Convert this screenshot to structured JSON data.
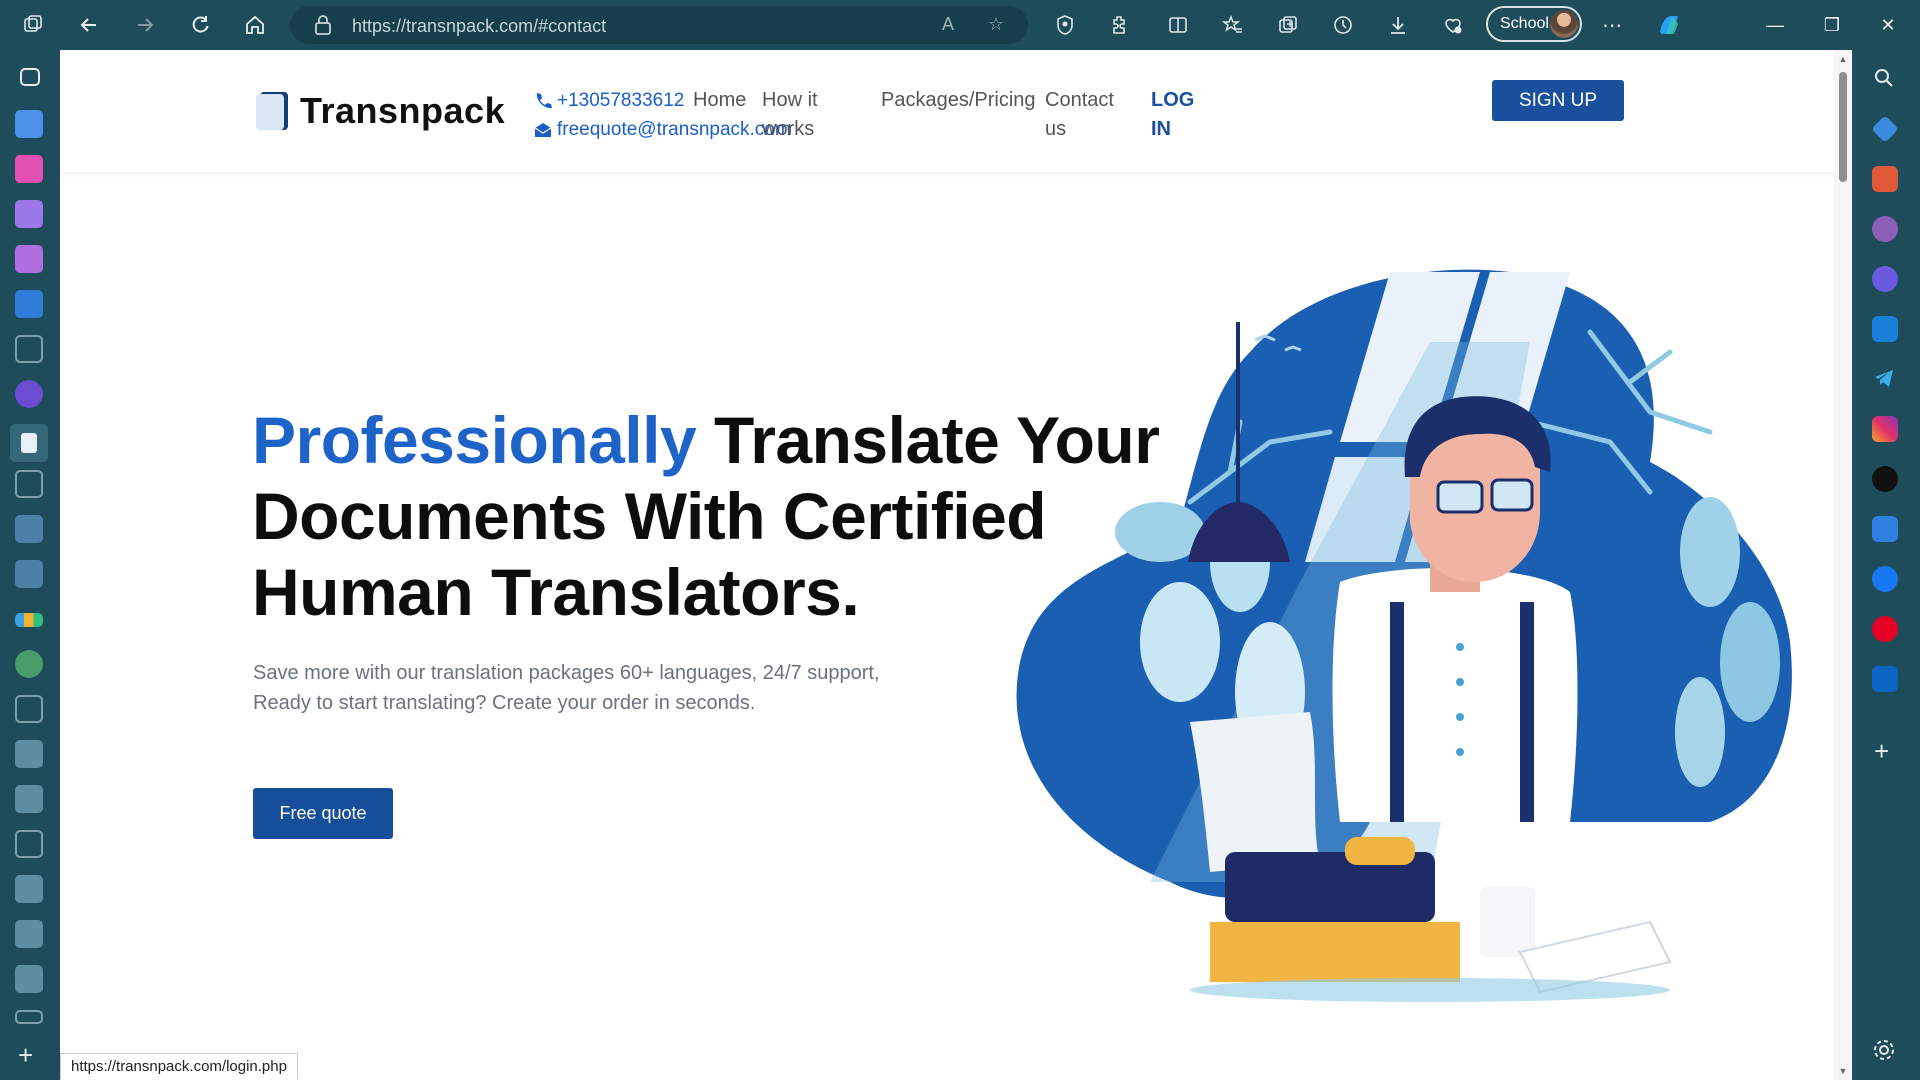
{
  "browser": {
    "url": "https://transnpack.com/#contact",
    "profile_label": "School",
    "status_url": "https://transnpack.com/login.php"
  },
  "site": {
    "logo_text": "Transnpack",
    "phone": "+13057833612",
    "email": "freequote@transnpack.com",
    "nav": {
      "home": "Home",
      "how_it_works_1": "How it",
      "how_it_works_2": "works",
      "packages": "Packages/Pricing",
      "contact_1": "Contact",
      "contact_2": "us",
      "login_1": "LOG",
      "login_2": "IN",
      "signup": "SIGN UP"
    }
  },
  "hero": {
    "title_accent": "Professionally",
    "title_rest_1": "Translate Your",
    "title_line_2": "Documents With Certified",
    "title_line_3": "Human Translators.",
    "subtitle_1": "Save more with our translation packages 60+ languages, 24/7 support,",
    "subtitle_2": "Ready to start translating? Create your order in seconds.",
    "cta": "Free quote"
  },
  "colors": {
    "accent": "#1d63c8",
    "button": "#164e9c",
    "chrome": "#1f4c5a"
  }
}
